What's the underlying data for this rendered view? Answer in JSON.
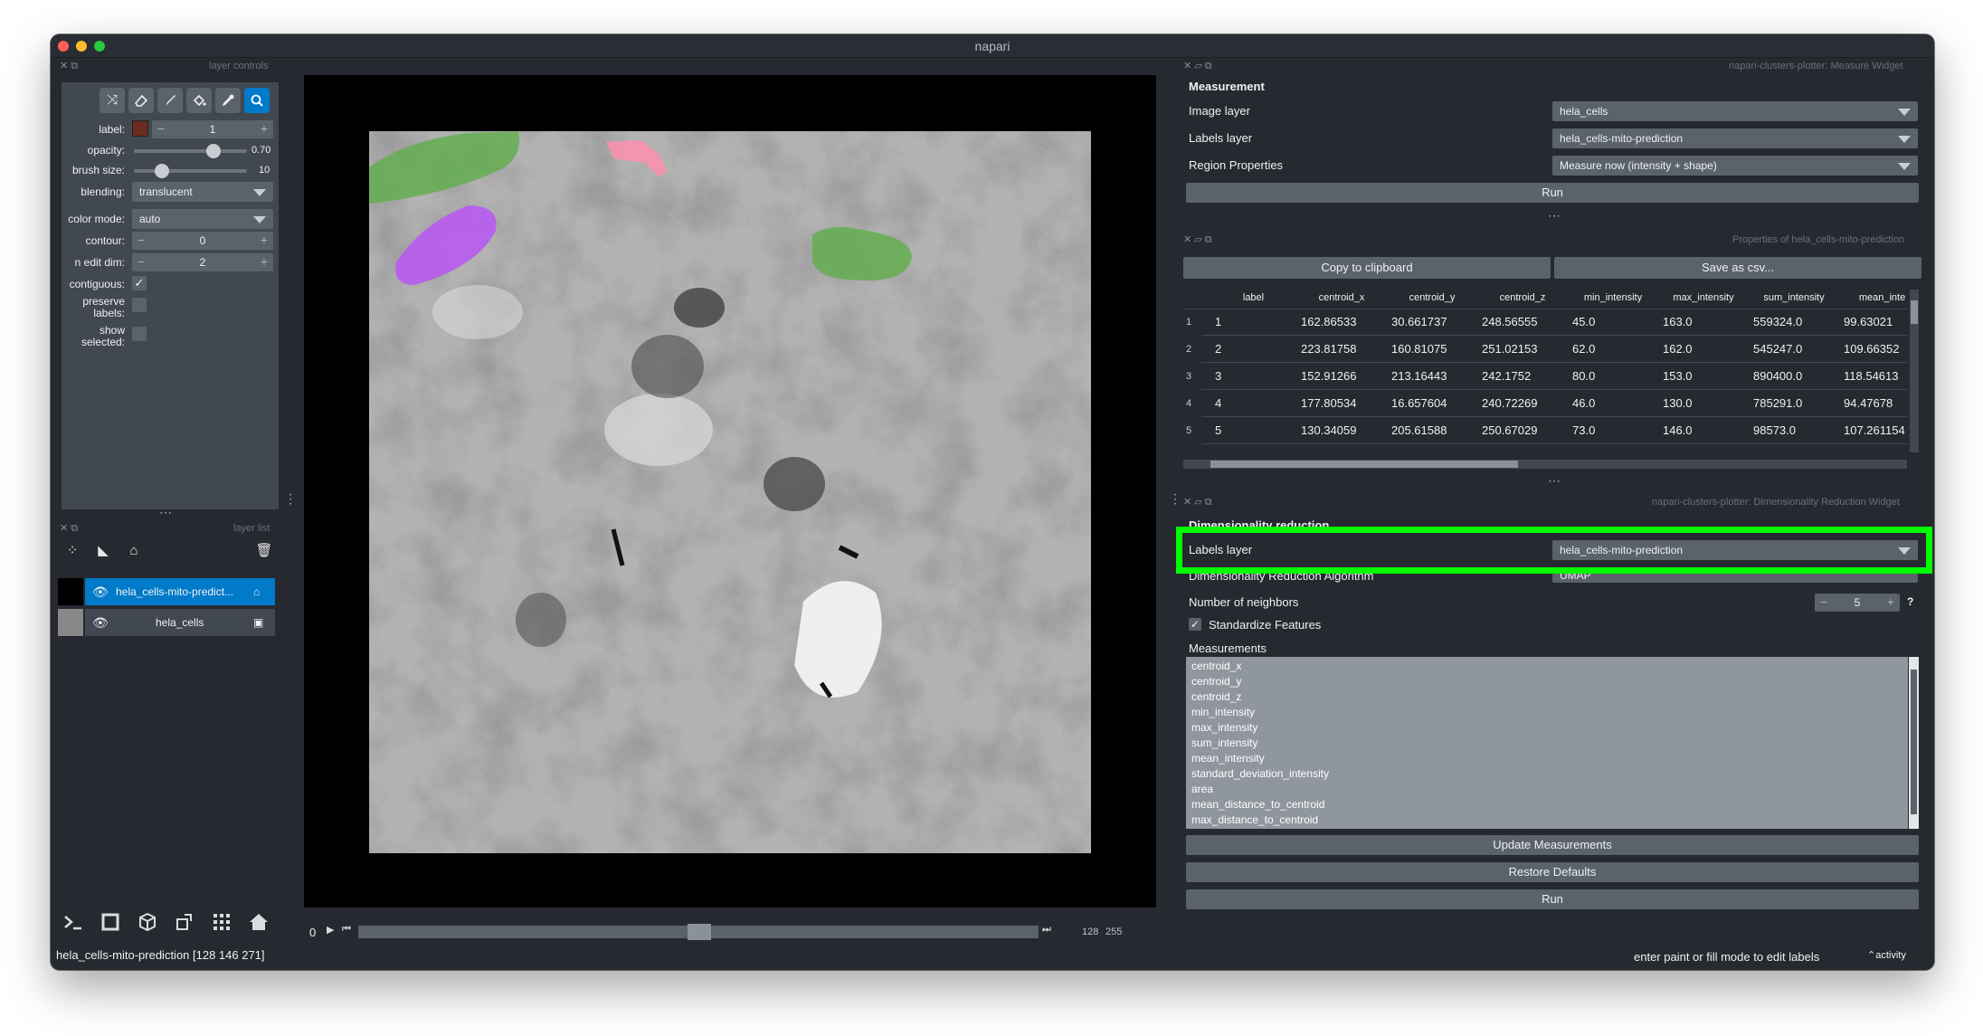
{
  "window": {
    "title": "napari"
  },
  "colors": {
    "accent": "#007ac9",
    "highlight_box": "#00ff00",
    "label_swatch": "#6a2c1e"
  },
  "layer_controls": {
    "title": "layer controls",
    "tools": [
      "shuffle-icon",
      "eraser-icon",
      "brush-icon",
      "fill-icon",
      "picker-icon",
      "zoom-icon"
    ],
    "label_text": "label:",
    "label_value": "1",
    "opacity_label": "opacity:",
    "opacity_value": "0.70",
    "opacity_fraction": 0.7,
    "brush_label": "brush size:",
    "brush_value": "10",
    "brush_fraction": 0.25,
    "blending_label": "blending:",
    "blending_value": "translucent",
    "colormode_label": "color mode:",
    "colormode_value": "auto",
    "contour_label": "contour:",
    "contour_value": "0",
    "nedit_label": "n edit dim:",
    "nedit_value": "2",
    "contiguous_label": "contiguous:",
    "preserve_label_1": "preserve",
    "preserve_label_2": "labels:",
    "show_label_1": "show",
    "show_label_2": "selected:"
  },
  "layer_list": {
    "title": "layer list",
    "layers": [
      {
        "name": "hela_cells-mito-predict...",
        "selected": true
      },
      {
        "name": "hela_cells",
        "selected": false
      }
    ]
  },
  "viewer": {
    "slider_value": "0",
    "dim_current": "128",
    "dim_total": "255"
  },
  "status": {
    "left": "hela_cells-mito-prediction [128 146 271]",
    "right": "enter paint or fill mode to edit labels",
    "activity": "activity"
  },
  "measure_widget": {
    "title": "napari-clusters-plotter: Measure Widget",
    "heading": "Measurement",
    "image_layer_label": "Image layer",
    "image_layer_value": "hela_cells",
    "labels_layer_label": "Labels layer",
    "labels_layer_value": "hela_cells-mito-prediction",
    "region_props_label": "Region Properties",
    "region_props_value": "Measure now (intensity + shape)",
    "run_label": "Run"
  },
  "properties": {
    "title": "Properties of hela_cells-mito-prediction",
    "copy_label": "Copy to clipboard",
    "save_label": "Save as csv...",
    "columns": [
      "label",
      "centroid_x",
      "centroid_y",
      "centroid_z",
      "min_intensity",
      "max_intensity",
      "sum_intensity",
      "mean_inte"
    ],
    "rows": [
      {
        "n": "1",
        "cells": [
          "1",
          "162.86533",
          "30.661737",
          "248.56555",
          "45.0",
          "163.0",
          "559324.0",
          "99.63021"
        ]
      },
      {
        "n": "2",
        "cells": [
          "2",
          "223.81758",
          "160.81075",
          "251.02153",
          "62.0",
          "162.0",
          "545247.0",
          "109.66352"
        ]
      },
      {
        "n": "3",
        "cells": [
          "3",
          "152.91266",
          "213.16443",
          "242.1752",
          "80.0",
          "153.0",
          "890400.0",
          "118.54613"
        ]
      },
      {
        "n": "4",
        "cells": [
          "4",
          "177.80534",
          "16.657604",
          "240.72269",
          "46.0",
          "130.0",
          "785291.0",
          "94.47678"
        ]
      },
      {
        "n": "5",
        "cells": [
          "5",
          "130.34059",
          "205.61588",
          "250.67029",
          "73.0",
          "146.0",
          "98573.0",
          "107.261154"
        ]
      }
    ]
  },
  "dimred_widget": {
    "title": "napari-clusters-plotter: Dimensionality Reduction Widget",
    "heading": "Dimensionality reduction",
    "labels_layer_label": "Labels layer",
    "labels_layer_value": "hela_cells-mito-prediction",
    "algorithm_label": "Dimensionality Reduction Algorithm",
    "algorithm_value": "UMAP",
    "neighbors_label": "Number of neighbors",
    "neighbors_value": "5",
    "help": "?",
    "standardize_label": "Standardize Features",
    "measurements_label": "Measurements",
    "measurements": [
      "centroid_x",
      "centroid_y",
      "centroid_z",
      "min_intensity",
      "max_intensity",
      "sum_intensity",
      "mean_intensity",
      "standard_deviation_intensity",
      "area",
      "mean_distance_to_centroid",
      "max_distance_to_centroid"
    ],
    "update_label": "Update Measurements",
    "restore_label": "Restore Defaults",
    "run_label": "Run"
  }
}
